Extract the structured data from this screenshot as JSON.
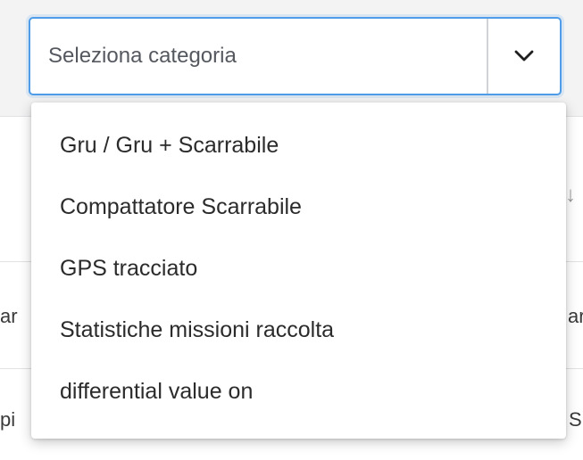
{
  "select": {
    "placeholder": "Seleziona categoria",
    "toggle_icon": "chevron-down-icon"
  },
  "dropdown": {
    "options": [
      "Gru / Gru + Scarrabile",
      "Compattatore Scarrabile",
      "GPS tracciato",
      "Statistiche missioni raccolta",
      "differential value on"
    ]
  },
  "background": {
    "row1_left": "ar",
    "row1_right": "ar",
    "row2_left": "pi",
    "row2_right": "S",
    "sort_icon": "arrow-down-icon"
  },
  "colors": {
    "accent": "#4f9ce8",
    "band": "#f3f3f4"
  }
}
